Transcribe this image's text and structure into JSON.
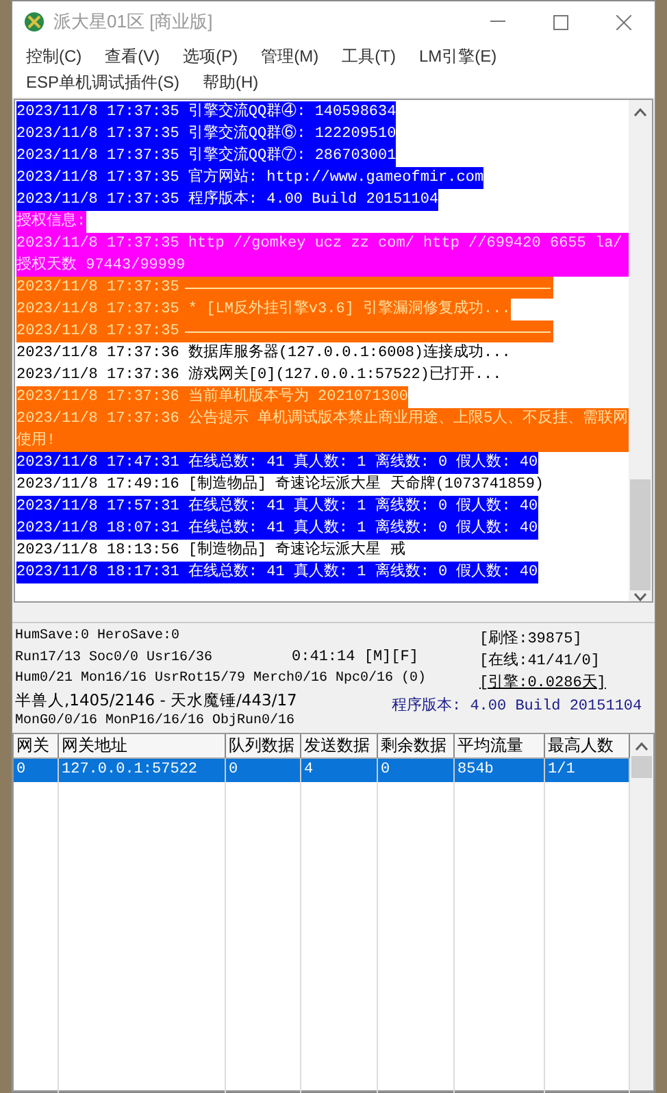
{
  "window": {
    "title": "派大星01区 [商业版]"
  },
  "menu": [
    "控制(C)",
    "查看(V)",
    "选项(P)",
    "管理(M)",
    "工具(T)",
    "LM引擎(E)",
    "ESP单机调试插件(S)",
    "帮助(H)"
  ],
  "log": [
    {
      "kind": "text",
      "text": "2023/11/8 17:37:35 引擎交流QQ群④: 140598634",
      "color": "#0000ff"
    },
    {
      "kind": "text",
      "text": "2023/11/8 17:37:35 引擎交流QQ群⑥: 122209510",
      "color": "#0000ff"
    },
    {
      "kind": "text",
      "text": "2023/11/8 17:37:35 引擎交流QQ群⑦: 286703001",
      "color": "#0000ff"
    },
    {
      "kind": "text",
      "text": "2023/11/8 17:37:35 官方网站: http://www.gameofmir.com",
      "color": "#0000ff"
    },
    {
      "kind": "text",
      "text": "2023/11/8 17:37:35 程序版本: 4.00 Build 20151104",
      "color": "#0000ff"
    },
    {
      "kind": "text",
      "text": "授权信息:",
      "color": "#ff00ff"
    },
    {
      "kind": "text",
      "text": "2023/11/8 17:37:35 http //gomkey ucz zz com/ http //699420 6655 la/ 授权天数 97443/99999",
      "color": "#ff00ff"
    },
    {
      "kind": "rule",
      "text": "2023/11/8 17:37:35",
      "color": "#ff6a00"
    },
    {
      "kind": "text",
      "text": "2023/11/8 17:37:35 * [LM反外挂引擎v3.6] 引擎漏洞修复成功...",
      "color": "#ff6a00"
    },
    {
      "kind": "rule",
      "text": "2023/11/8 17:37:35",
      "color": "#ff6a00"
    },
    {
      "kind": "text",
      "text": "2023/11/8 17:37:36 数据库服务器(127.0.0.1:6008)连接成功..."
    },
    {
      "kind": "text",
      "text": "2023/11/8 17:37:36 游戏网关[0](127.0.0.1:57522)已打开..."
    },
    {
      "kind": "text",
      "text": "2023/11/8 17:37:36 当前单机版本号为 2021071300",
      "color": "#ff6a00"
    },
    {
      "kind": "text",
      "text": "2023/11/8 17:37:36 公告提示 单机调试版本禁止商业用途、上限5人、不反挂、需联网使用!",
      "color": "#ff6a00"
    },
    {
      "kind": "text",
      "text": "2023/11/8 17:47:31 在线总数: 41 真人数: 1 离线数: 0 假人数: 40",
      "color": "#0000ff"
    },
    {
      "kind": "text",
      "text": "2023/11/8 17:49:16 [制造物品] 奇速论坛派大星 天命牌(1073741859)"
    },
    {
      "kind": "text",
      "text": "2023/11/8 17:57:31 在线总数: 41 真人数: 1 离线数: 0 假人数: 40",
      "color": "#0000ff"
    },
    {
      "kind": "text",
      "text": "2023/11/8 18:07:31 在线总数: 41 真人数: 1 离线数: 0 假人数: 40",
      "color": "#0000ff"
    },
    {
      "kind": "text",
      "text": "2023/11/8 18:13:56 [制造物品] 奇速论坛派大星 戒"
    },
    {
      "kind": "text",
      "text": "2023/11/8 18:17:31 在线总数: 41 真人数: 1 离线数: 0 假人数: 40",
      "color": "#0000ff"
    }
  ],
  "status": {
    "left": [
      "HumSave:0 HeroSave:0",
      "Run17/13 Soc0/0 Usr16/36",
      "Hum0/21 Mon16/16 UsrRot15/79 Merch0/16 Npc0/16 (0)",
      "半兽人,1405/2146 - 天水魔锤/443/17",
      "MonG0/0/16 MonP16/16/16 ObjRun0/16"
    ],
    "timer": "0:41:14 [M][F]",
    "right": [
      "[刷怪:39875]",
      "[在线:41/41/0]",
      "[引擎:0.0286天]"
    ],
    "version": "程序版本: 4.00 Build 20151104"
  },
  "table": {
    "columns": [
      "网关",
      "网关地址",
      "队列数据",
      "发送数据",
      "剩余数据",
      "平均流量",
      "最高人数"
    ],
    "rows": [
      {
        "selected": true,
        "cells": [
          "0",
          "127.0.0.1:57522",
          "0",
          "4",
          "0",
          "854b",
          "1/1"
        ]
      }
    ]
  }
}
